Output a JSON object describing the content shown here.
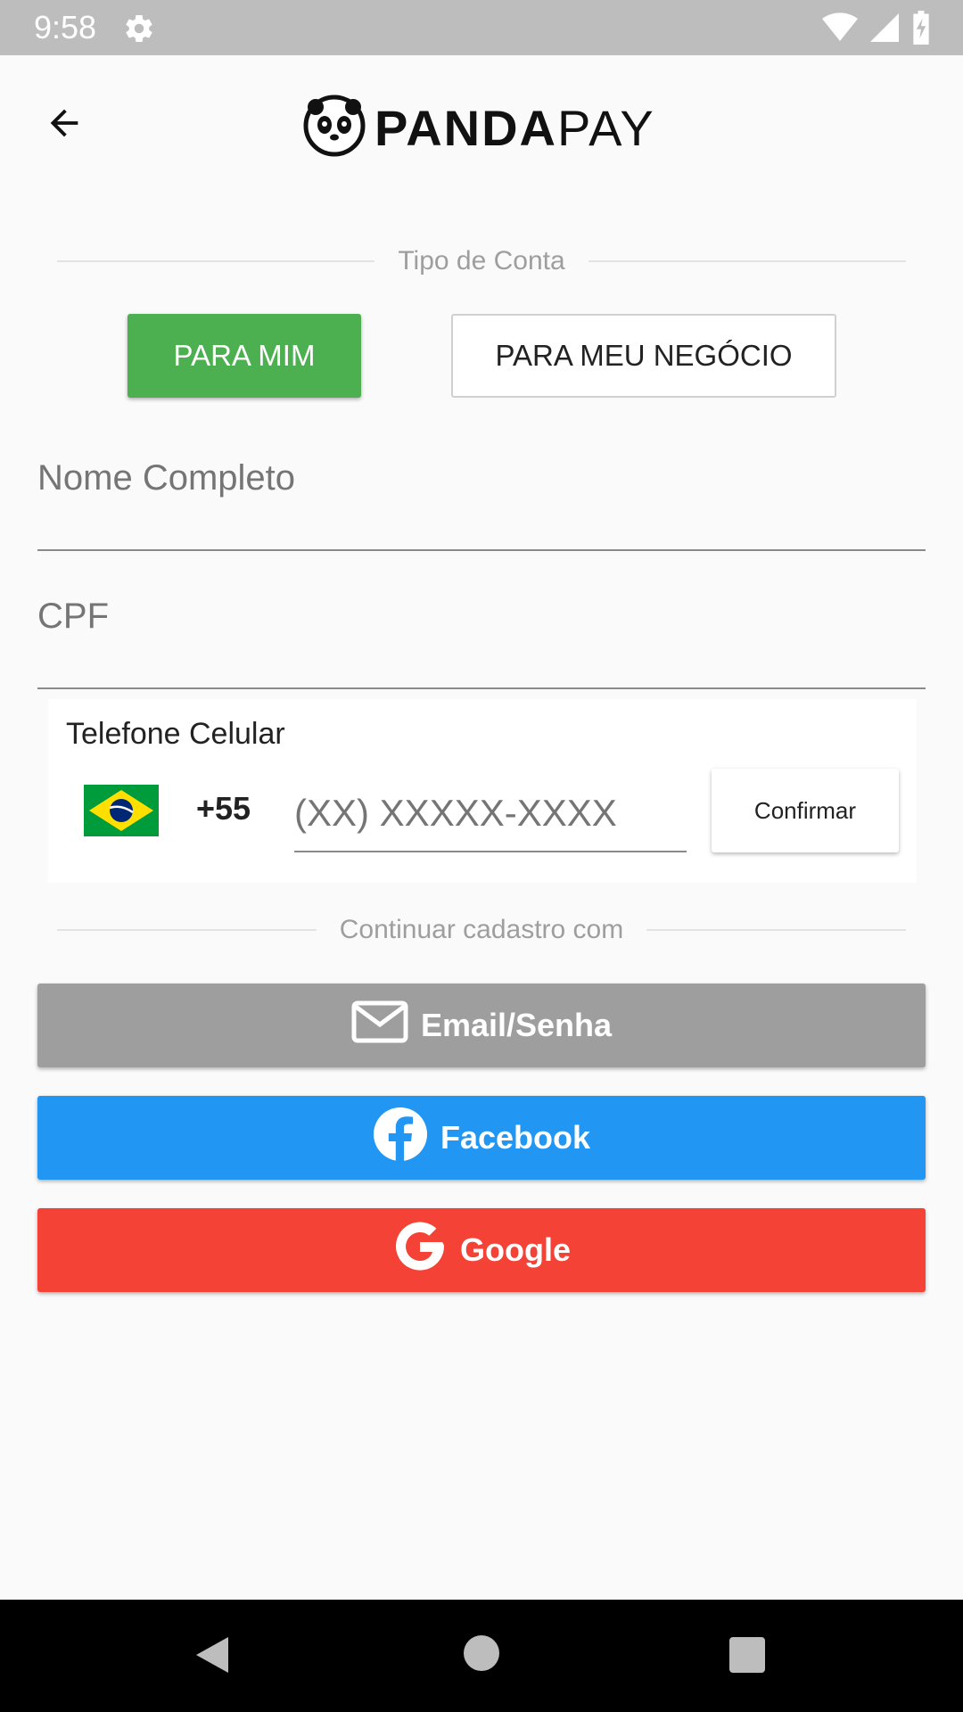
{
  "status_bar": {
    "time": "9:58",
    "icons": [
      "gear-icon",
      "wifi-icon",
      "signal-icon",
      "battery-charging-icon"
    ]
  },
  "header": {
    "back_icon": "arrow-left-icon",
    "logo_bold": "PANDA",
    "logo_thin": "PAY",
    "logo_icon": "panda-face-icon"
  },
  "account_type": {
    "label": "Tipo de Conta",
    "personal_label": "PARA MIM",
    "business_label": "PARA MEU NEGÓCIO",
    "selected": "PARA MIM",
    "selected_color": "#4caf50"
  },
  "form": {
    "name_placeholder": "Nome Completo",
    "cpf_placeholder": "CPF"
  },
  "phone": {
    "label": "Telefone Celular",
    "flag": "brazil-flag-icon",
    "country_code": "+55",
    "placeholder": "(XX) XXXXX-XXXX",
    "confirm_label": "Confirmar"
  },
  "continue_with": {
    "label": "Continuar cadastro com",
    "buttons": [
      {
        "label": "Email/Senha",
        "icon": "envelope-icon",
        "color": "#9e9e9e"
      },
      {
        "label": "Facebook",
        "icon": "facebook-icon",
        "color": "#2196f3"
      },
      {
        "label": "Google",
        "icon": "google-icon",
        "color": "#f44336"
      }
    ]
  },
  "nav_bar": {
    "icons": [
      "nav-back-icon",
      "nav-home-icon",
      "nav-recents-icon"
    ]
  }
}
